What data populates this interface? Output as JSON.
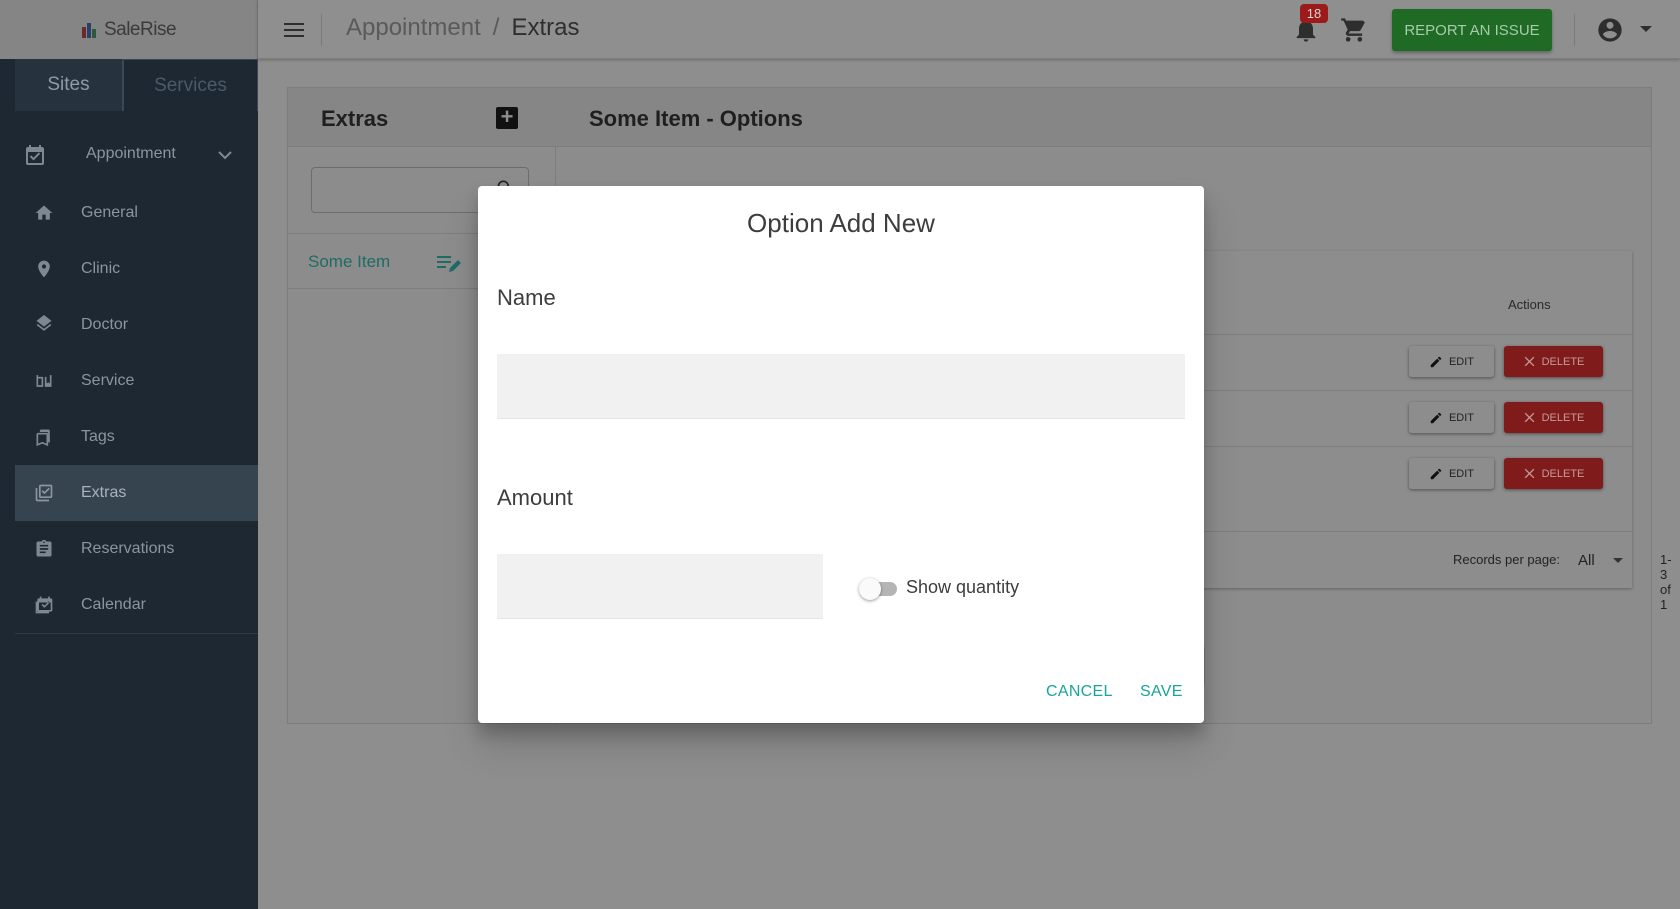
{
  "app": {
    "logo_text": "SaleRise"
  },
  "header": {
    "breadcrumb": [
      "Appointment",
      "/",
      "Extras"
    ],
    "notification_count": "18",
    "report_label": "REPORT AN ISSUE"
  },
  "sidebar": {
    "tabs": [
      "Sites",
      "Services"
    ],
    "group_label": "Appointment",
    "items": [
      {
        "label": "General",
        "icon": "home-icon"
      },
      {
        "label": "Clinic",
        "icon": "map-pin-icon"
      },
      {
        "label": "Doctor",
        "icon": "layers-icon"
      },
      {
        "label": "Service",
        "icon": "book-icon"
      },
      {
        "label": "Tags",
        "icon": "bookmark-icon"
      },
      {
        "label": "Extras",
        "icon": "checklist-icon",
        "active": true
      },
      {
        "label": "Reservations",
        "icon": "clipboard-icon"
      },
      {
        "label": "Calendar",
        "icon": "calendar-check-icon"
      }
    ]
  },
  "extras_panel": {
    "title": "Extras",
    "items": [
      "Some Item"
    ]
  },
  "options_panel": {
    "title": "Some Item - Options",
    "actions_header": "Actions",
    "rows": [
      {
        "edit_label": "EDIT",
        "delete_label": "DELETE"
      },
      {
        "edit_label": "EDIT",
        "delete_label": "DELETE"
      },
      {
        "edit_label": "EDIT",
        "delete_label": "DELETE"
      }
    ],
    "records_per_page_label": "Records per page:",
    "records_per_page_value": "All",
    "range_text": "1-3 of 1"
  },
  "modal": {
    "title": "Option Add New",
    "name_label": "Name",
    "name_value": "",
    "amount_label": "Amount",
    "amount_value": "",
    "show_quantity_label": "Show quantity",
    "show_quantity_on": false,
    "cancel_label": "CANCEL",
    "save_label": "SAVE"
  },
  "colors": {
    "sidebar_bg": "#1d2833",
    "accent": "#17a59b",
    "report_button": "#2e7d32",
    "delete_button": "#c62828",
    "badge": "#c62828"
  }
}
